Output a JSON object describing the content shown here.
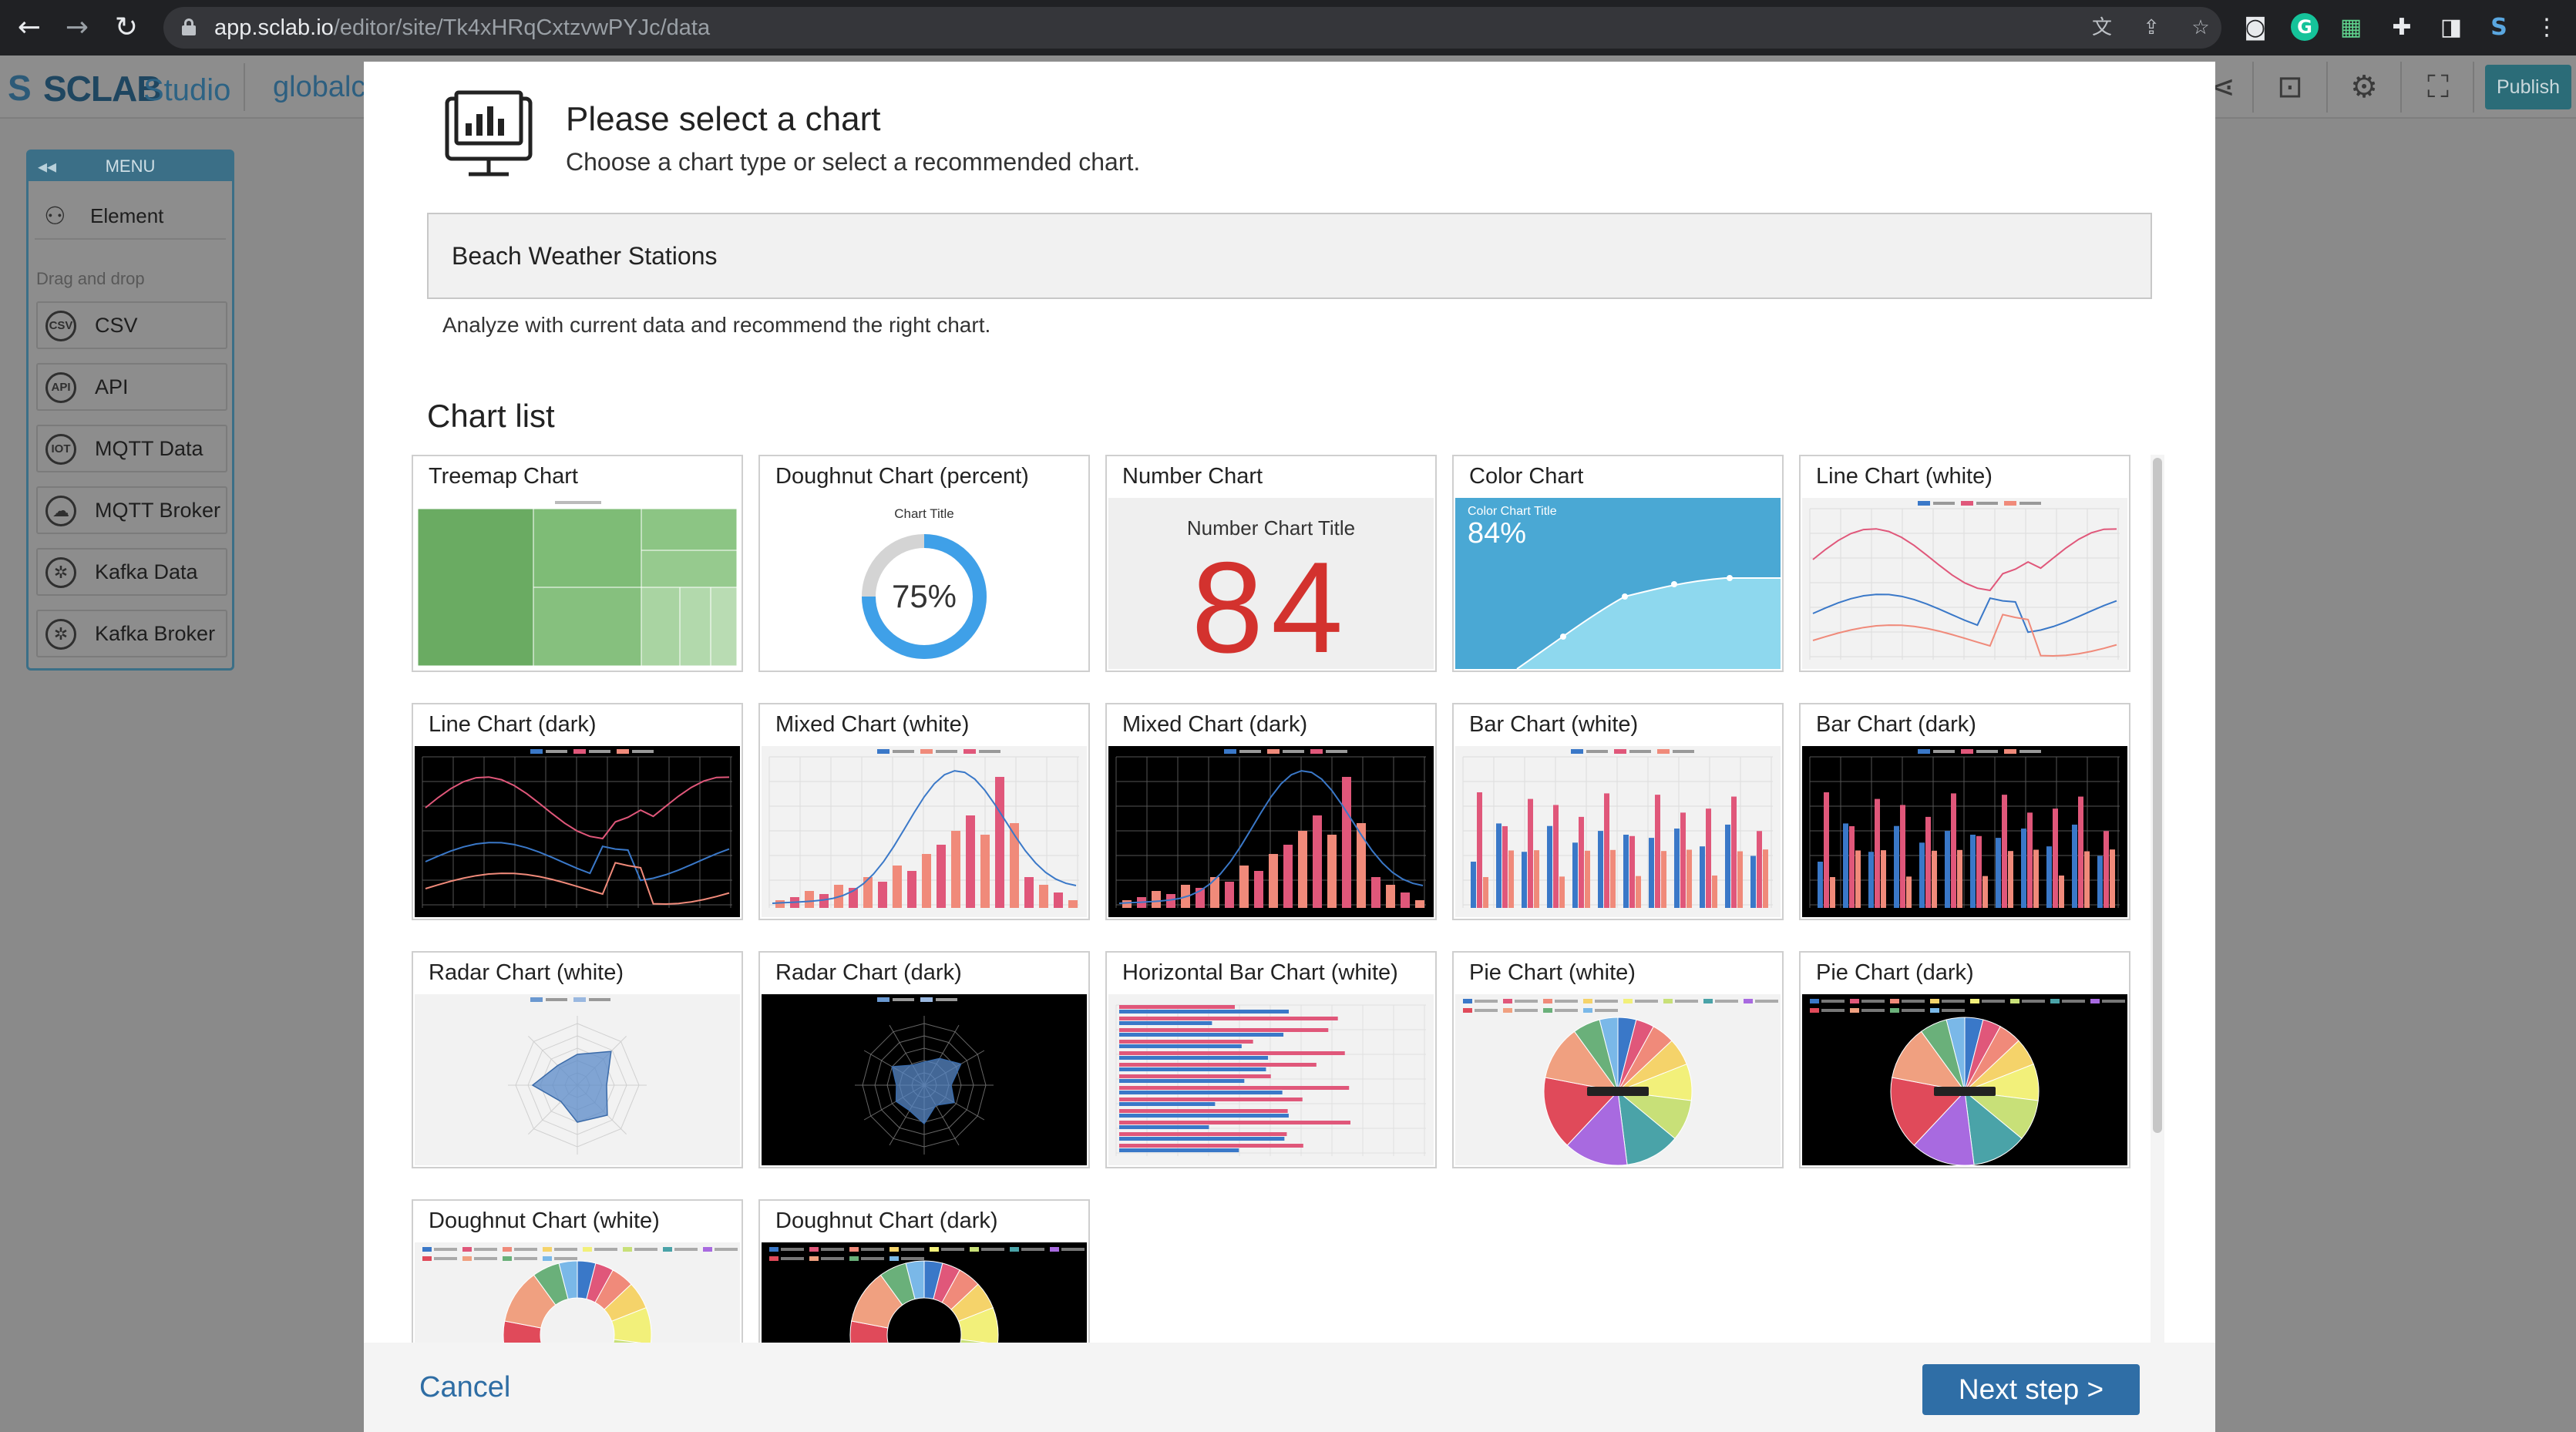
{
  "browser": {
    "url_host": "app.sclab.io",
    "url_path": "/editor/site/Tk4xHRqCxtzvwPYJc/data",
    "icons": [
      "back-icon",
      "forward-icon",
      "reload-icon",
      "lock-icon",
      "translate-icon",
      "share-icon",
      "bookmark-star-icon",
      "camera-icon",
      "grammarly-icon",
      "extension-icon",
      "puzzle-icon",
      "sidepanel-icon",
      "sclab-extension-icon",
      "kebab-menu-icon"
    ]
  },
  "header": {
    "logo_mark": "S",
    "logo_text": "SCLAB",
    "logo_sub": "Studio",
    "site_name": "globalc",
    "publish_label": "Publish",
    "icons": [
      "share-icon",
      "unlock-icon",
      "gear-icon",
      "fullscreen-icon"
    ]
  },
  "menu": {
    "title": "MENU",
    "element_label": "Element",
    "drag_drop_label": "Drag and drop",
    "items": [
      {
        "label": "CSV",
        "badge": "CSV",
        "icon": "csv-icon"
      },
      {
        "label": "API",
        "badge": "API",
        "icon": "api-icon"
      },
      {
        "label": "MQTT Data",
        "badge": "IOT",
        "icon": "iot-icon"
      },
      {
        "label": "MQTT Broker",
        "badge": "☁",
        "icon": "cloud-icon"
      },
      {
        "label": "Kafka Data",
        "badge": "✲",
        "icon": "kafka-icon"
      },
      {
        "label": "Kafka Broker",
        "badge": "✲",
        "icon": "kafka-icon"
      }
    ]
  },
  "modal": {
    "title": "Please select a chart",
    "subtitle": "Choose a chart type or select a recommended chart.",
    "dataset_name": "Beach Weather Stations",
    "analyze_text": "Analyze with current data and recommend the right chart.",
    "chart_list_title": "Chart list",
    "cancel_label": "Cancel",
    "next_label": "Next step >",
    "cards": [
      {
        "label": "Treemap Chart",
        "kind": "treemap"
      },
      {
        "label": "Doughnut Chart (percent)",
        "kind": "doughnut-percent",
        "thumb_title": "Chart  Title",
        "value": "75%"
      },
      {
        "label": "Number Chart",
        "kind": "number",
        "thumb_title": "Number Chart Title",
        "value": "84"
      },
      {
        "label": "Color Chart",
        "kind": "color",
        "thumb_title": "Color Chart Title",
        "value": "84%"
      },
      {
        "label": "Line Chart (white)",
        "kind": "line-white"
      },
      {
        "label": "Line Chart (dark)",
        "kind": "line-dark"
      },
      {
        "label": "Mixed Chart (white)",
        "kind": "mixed-white"
      },
      {
        "label": "Mixed Chart (dark)",
        "kind": "mixed-dark"
      },
      {
        "label": "Bar Chart (white)",
        "kind": "bar-white"
      },
      {
        "label": "Bar Chart (dark)",
        "kind": "bar-dark"
      },
      {
        "label": "Radar Chart (white)",
        "kind": "radar-white"
      },
      {
        "label": "Radar Chart (dark)",
        "kind": "radar-dark"
      },
      {
        "label": "Horizontal Bar Chart (white)",
        "kind": "hbar-white"
      },
      {
        "label": "Pie Chart (white)",
        "kind": "pie-white"
      },
      {
        "label": "Pie Chart (dark)",
        "kind": "pie-dark"
      },
      {
        "label": "Doughnut Chart (white)",
        "kind": "doughnut-white"
      },
      {
        "label": "Doughnut Chart (dark)",
        "kind": "doughnut-dark"
      }
    ]
  },
  "colors": {
    "accent_blue": "#2f6ea6",
    "teal": "#3b6f87",
    "treemap_green": "#6aab62",
    "doughnut_blue": "#3fa0e8",
    "number_red": "#d3322e",
    "color_chart_bg": "#4aa8d4",
    "series_blue": "#3a78c8",
    "series_red": "#e0577a",
    "series_salmon": "#f08a7a"
  }
}
